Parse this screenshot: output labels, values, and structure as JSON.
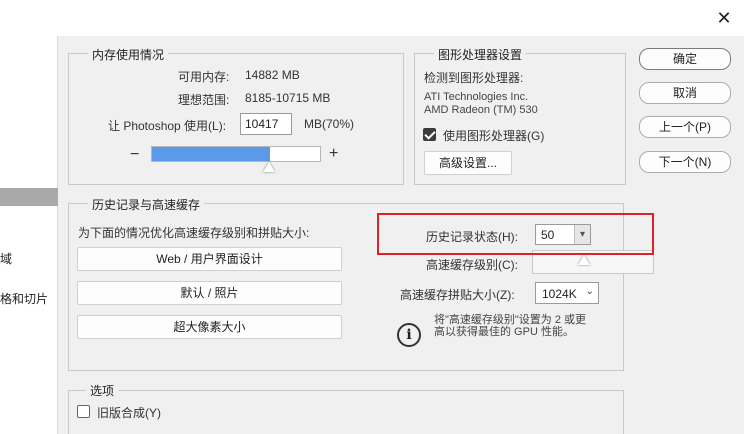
{
  "dialog": {
    "close_glyph": "✕"
  },
  "left_nav": {
    "item_partial_1": "域",
    "item_partial_2": "格和切片"
  },
  "memory": {
    "title": "内存使用情况",
    "available_label": "可用内存:",
    "available_value": "14882 MB",
    "ideal_label": "理想范围:",
    "ideal_value": "8185-10715 MB",
    "let_label": "让 Photoshop 使用(L):",
    "let_value": "10417",
    "percent_label": "MB(70%)",
    "minus": "−",
    "plus": "+",
    "slider_fraction": 0.7,
    "slider_color": "#5b9ae8"
  },
  "gpu": {
    "title": "图形处理器设置",
    "detected_label": "检测到图形处理器:",
    "vendor": "ATI Technologies Inc.",
    "model": "AMD Radeon (TM) 530",
    "use_gpu_label": "使用图形处理器(G)",
    "use_gpu_checked": true,
    "advanced_button": "高级设置..."
  },
  "buttons": {
    "ok": "确定",
    "cancel": "取消",
    "prev": "上一个(P)",
    "next": "下一个(N)"
  },
  "history": {
    "title": "历史记录与高速缓存",
    "optimize_label": "为下面的情况优化高速缓存级别和拼贴大小:",
    "preset_web": "Web / 用户界面设计",
    "preset_default": "默认 / 照片",
    "preset_huge": "超大像素大小",
    "states_label": "历史记录状态(H):",
    "states_value": "50",
    "cache_levels_label": "高速缓存级别(C):",
    "tile_size_label": "高速缓存拼贴大小(Z):",
    "tile_size_value": "1024K",
    "info_glyph": "i",
    "info_text_1": "将\"高速缓存级别\"设置为 2 或更",
    "info_text_2": "高以获得最佳的 GPU 性能。",
    "highlight_color": "#e0202a"
  },
  "options": {
    "title": "选项",
    "legacy_label": "旧版合成(Y)",
    "legacy_checked": false
  }
}
